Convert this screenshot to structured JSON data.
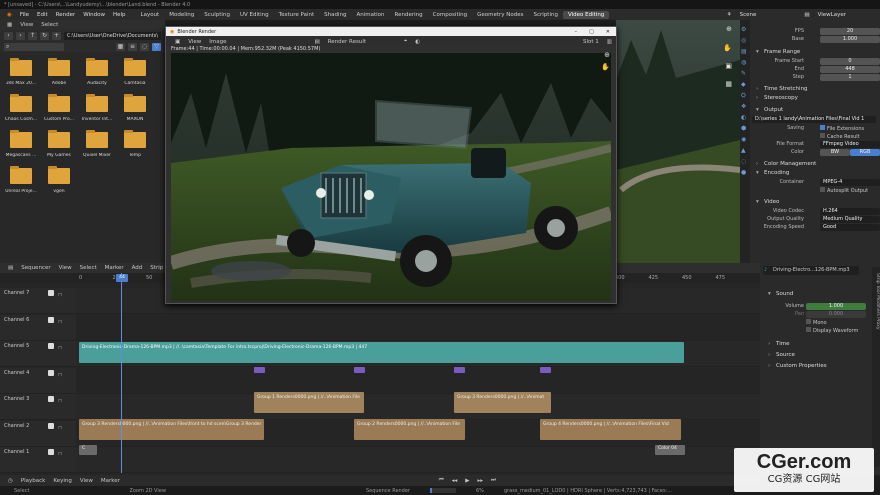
{
  "window": {
    "title": "* [unsaved] - C:\\Users\\...\\Landyudemy\\...\\blender\\Land.blend - Blender 4.0"
  },
  "menu": {
    "items": [
      "File",
      "Edit",
      "Render",
      "Window",
      "Help"
    ],
    "workspaces": [
      "Layout",
      "Modeling",
      "Sculpting",
      "UV Editing",
      "Texture Paint",
      "Shading",
      "Animation",
      "Rendering",
      "Compositing",
      "Geometry Nodes",
      "Scripting",
      "Video Editing"
    ],
    "active_workspace": "Video Editing",
    "scene": "Scene",
    "view_layer": "ViewLayer"
  },
  "file_browser": {
    "header": [
      "View",
      "Select"
    ],
    "path": "C:\\Users\\User\\OneDrive\\Documents\\",
    "folders": [
      "3ds Max 20...",
      "Adobe",
      "Audacity",
      "Camtasia",
      "Chaos Cosm...",
      "Custom Pro...",
      "Inventor Int...",
      "MAXON",
      "Megascans ...",
      "My Games",
      "Quixel Mixer",
      "Temp",
      "Unreal Proje...",
      "vgen"
    ]
  },
  "properties": {
    "fps": {
      "label": "FPS",
      "value": "20"
    },
    "base": {
      "label": "Base",
      "value": "1.000"
    },
    "frame_range": {
      "title": "Frame Range",
      "start_label": "Frame Start",
      "start": "0",
      "end_label": "End",
      "end": "448",
      "step_label": "Step",
      "step": "1"
    },
    "time_stretching": "Time Stretching",
    "stereoscopy": "Stereoscopy",
    "output": {
      "title": "Output",
      "path": "D:\\series 1 landy\\Animation Files\\Final Vid 1",
      "saving_label": "Saving",
      "file_extensions": "File Extensions",
      "cache_result": "Cache Result",
      "file_format_label": "File Format",
      "file_format": "FFmpeg Video",
      "color_label": "Color",
      "bw": "BW",
      "rgb": "RGB"
    },
    "color_management": "Color Management",
    "encoding": {
      "title": "Encoding",
      "container_label": "Container",
      "container": "MPEG-4",
      "autosplit": "Autosplit Output"
    },
    "video": {
      "title": "Video",
      "codec_label": "Video Codec",
      "codec": "H.264",
      "quality_label": "Output Quality",
      "quality": "Medium Quality",
      "speed_label": "Encoding Speed",
      "speed": "Good"
    }
  },
  "render_window": {
    "title": "Blender Render",
    "menu": [
      "View",
      "Image"
    ],
    "slot_label": "Render Result",
    "slot": "Slot 1",
    "info": "Frame:44 | Time:00:00.04 | Mem:952.32M (Peak 4150.57M)"
  },
  "sequencer": {
    "header": [
      "Sequencer",
      "View",
      "Select",
      "Marker",
      "Add",
      "Strip"
    ],
    "ruler": [
      "0",
      "25",
      "44",
      "50",
      "75",
      "100",
      "125",
      "150",
      "175",
      "200",
      "225",
      "250",
      "275",
      "300",
      "325",
      "350",
      "375",
      "400",
      "425",
      "450",
      "475"
    ],
    "current_frame": "44",
    "channels": [
      "Channel 7",
      "Channel 6",
      "Channel 5",
      "Channel 4",
      "Channel 3",
      "Channel 2",
      "Channel 1"
    ],
    "strips": {
      "audio": "Driving-Electronic-Drama-126-BPM.mp3 | //..\\camtasia\\Template For intro.tscproj\\Driving-Electronic-Drama-126-BPM.mp3 | 447",
      "c3a": "Group 1 Renders0000.png | //..\\Animation File",
      "c3b": "Group 3 Renders0000.png | //..\\Animat",
      "c2a": "Group 3 Renders0000.png | //..\\Animation Files\\front to hd scen\\Group 3 Render",
      "c2b": "Group 2 Renders0000.png | //..\\Animation File",
      "c2c": "Group 4 Renders0000.png | //..\\Animation Files\\Final Vid",
      "c1a": "C",
      "c1b": "Color 04"
    }
  },
  "strip_props": {
    "strip_name": "Driving-Electro...126-BPM.mp3",
    "sound": "Sound",
    "volume_label": "Volume",
    "volume": "1.000",
    "pan_label": "Pan",
    "pan": "0.000",
    "mono": "Mono",
    "display_waveform": "Display Waveform",
    "time": "Time",
    "source": "Source",
    "custom_properties": "Custom Properties"
  },
  "timeline": {
    "items": [
      "Playback",
      "Keying",
      "View",
      "Marker"
    ]
  },
  "status": {
    "select": "Select",
    "zoom": "Zoom 2D View",
    "sequence_render": "Sequence Render",
    "pct": "6%",
    "info": "grass_medium_01_LOD0 | HDRI Sphere | Verts:4,723,743 | Faces:..."
  },
  "watermark": {
    "title": "CGer.com",
    "subtitle": "CG资源 CG网站"
  }
}
